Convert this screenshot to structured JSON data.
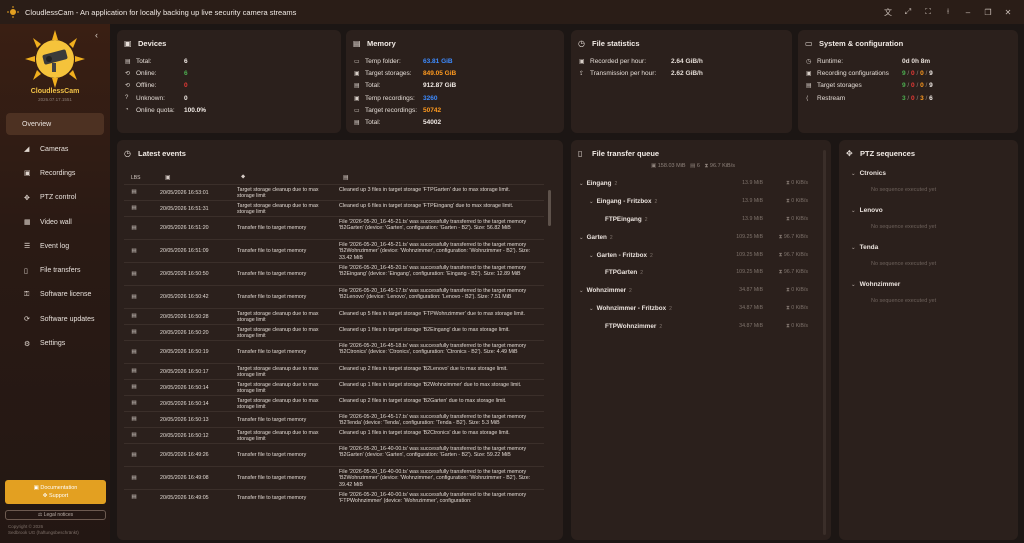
{
  "window": {
    "title": "CloudlessCam - An application for locally backing up live security camera streams",
    "controls": [
      "translate-icon",
      "fit-icon",
      "fullscreen-icon",
      "pin-icon",
      "minimize-icon",
      "restore-icon",
      "close-icon"
    ]
  },
  "sidebar": {
    "app_name": "CloudlessCam",
    "version": "2026.07.17.1551",
    "items": [
      {
        "label": "Overview",
        "icon": "home-icon",
        "active": true
      },
      {
        "label": "Cameras",
        "icon": "camera-icon"
      },
      {
        "label": "Recordings",
        "icon": "recordings-icon"
      },
      {
        "label": "PTZ control",
        "icon": "ptz-icon"
      },
      {
        "label": "Video wall",
        "icon": "grid-icon"
      },
      {
        "label": "Event log",
        "icon": "list-icon"
      },
      {
        "label": "File transfers",
        "icon": "file-icon"
      },
      {
        "label": "Software license",
        "icon": "key-icon"
      },
      {
        "label": "Software updates",
        "icon": "update-icon"
      },
      {
        "label": "Settings",
        "icon": "gear-icon"
      }
    ],
    "documentation_label": "Documentation",
    "support_label": "Support",
    "legal_label": "Legal notices",
    "copyright_line1": "Copyright © 2026",
    "copyright_line2": "Sedbrook UG (haftungsbeschränkt)",
    "accent": "#e3a021"
  },
  "devices": {
    "title": "Devices",
    "rows": [
      {
        "label": "Total:",
        "value": "6",
        "color": "#f2ebe6"
      },
      {
        "label": "Online:",
        "value": "6",
        "color": "#4caf50"
      },
      {
        "label": "Offline:",
        "value": "0",
        "color": "#e53935"
      },
      {
        "label": "Unknown:",
        "value": "0",
        "color": "#f2ebe6"
      },
      {
        "label": "Online quota:",
        "value": "100.0%",
        "color": "#f2ebe6"
      }
    ]
  },
  "memory": {
    "title": "Memory",
    "rows": [
      {
        "label": "Temp folder:",
        "value": "63.81 GiB",
        "color": "#3d8bff"
      },
      {
        "label": "Target storages:",
        "value": "849.05 GiB",
        "color": "#ff9a1f"
      },
      {
        "label": "Total:",
        "value": "912.87 GiB",
        "color": "#f2ebe6"
      },
      {
        "label": "Temp recordings:",
        "value": "3260",
        "color": "#3d8bff"
      },
      {
        "label": "Target recordings:",
        "value": "50742",
        "color": "#ff9a1f"
      },
      {
        "label": "Total:",
        "value": "54002",
        "color": "#f2ebe6"
      }
    ]
  },
  "file_statistics": {
    "title": "File statistics",
    "rows": [
      {
        "label": "Recorded per hour:",
        "value": "2.64 GiB/h"
      },
      {
        "label": "Transmission per hour:",
        "value": "2.62 GiB/h"
      }
    ]
  },
  "system": {
    "title": "System & configuration",
    "runtime_label": "Runtime:",
    "runtime_value": "0d 0h 8m",
    "rows": [
      {
        "label": "Recording configurations",
        "a": "9",
        "b": "0",
        "c": "0",
        "d": "9"
      },
      {
        "label": "Target storages",
        "a": "9",
        "b": "0",
        "c": "0",
        "d": "9"
      },
      {
        "label": "Restream",
        "a": "3",
        "b": "0",
        "c": "3",
        "d": "6"
      }
    ]
  },
  "latest_events": {
    "title": "Latest events",
    "col_source": "LBS",
    "rows": [
      {
        "icon": "doc-icon",
        "date": "20/05/2026 16:53:01",
        "type": "Target storage cleanup due to max storage limit",
        "msg": "Cleaned up 3 files in target storage 'FTPGarten' due to max storage limit.",
        "h": 16
      },
      {
        "icon": "doc-icon",
        "date": "20/05/2026 16:51:31",
        "type": "Target storage cleanup due to max storage limit",
        "msg": "Cleaned up 6 files in target storage 'FTPEingang' due to max storage limit.",
        "h": 16
      },
      {
        "icon": "doc-icon",
        "date": "20/05/2026 16:51:20",
        "type": "Transfer file to target memory",
        "msg": "File '2026-05-20_16-45-21.ts' was successfully transferred to the target memory 'B2Garten' (device: 'Garten', configuration: 'Garten - B2'). Size: 56.82 MiB",
        "h": 23
      },
      {
        "icon": "doc-icon",
        "date": "20/05/2026 16:51:09",
        "type": "Transfer file to target memory",
        "msg": "File '2026-05-20_16-45-21.ts' was successfully transferred to the target memory 'B2Wohnzimmer' (device: 'Wohnzimmer', configuration: 'Wohnzimmer - B2'). Size: 33.42 MiB",
        "h": 23
      },
      {
        "icon": "doc-icon",
        "date": "20/05/2026 16:50:50",
        "type": "Transfer file to target memory",
        "msg": "File '2026-05-20_16-45-20.ts' was successfully transferred to the target memory 'B2Eingang' (device: 'Eingang', configuration: 'Eingang - B2'). Size: 12.89 MiB",
        "h": 23
      },
      {
        "icon": "doc-icon",
        "date": "20/05/2026 16:50:42",
        "type": "Transfer file to target memory",
        "msg": "File '2026-05-20_16-45-17.ts' was successfully transferred to the target memory 'B2Lenovo' (device: 'Lenovo', configuration: 'Lenovo - B2'). Size: 7.51 MiB",
        "h": 23
      },
      {
        "icon": "doc-icon",
        "date": "20/05/2026 16:50:28",
        "type": "Target storage cleanup due to max storage limit",
        "msg": "Cleaned up 5 files in target storage 'FTPWohnzimmer' due to max storage limit.",
        "h": 16
      },
      {
        "icon": "doc-icon",
        "date": "20/05/2026 16:50:20",
        "type": "Target storage cleanup due to max storage limit",
        "msg": "Cleaned up 1 files in target storage 'B2Eingang' due to max storage limit.",
        "h": 16
      },
      {
        "icon": "doc-icon",
        "date": "20/05/2026 16:50:19",
        "type": "Transfer file to target memory",
        "msg": "File '2026-05-20_16-45-18.ts' was successfully transferred to the target memory 'B2Ctronics' (device: 'Ctronics', configuration: 'Ctronics - B2'). Size: 4.49 MiB",
        "h": 23
      },
      {
        "icon": "doc-icon",
        "date": "20/05/2026 16:50:17",
        "type": "Target storage cleanup due to max storage limit",
        "msg": "Cleaned up 2 files in target storage 'B2Lenovo' due to max storage limit.",
        "h": 16
      },
      {
        "icon": "doc-icon",
        "date": "20/05/2026 16:50:14",
        "type": "Target storage cleanup due to max storage limit",
        "msg": "Cleaned up 1 files in target storage 'B2Wohnzimmer' due to max storage limit.",
        "h": 16
      },
      {
        "icon": "doc-icon",
        "date": "20/05/2026 16:50:14",
        "type": "Target storage cleanup due to max storage limit",
        "msg": "Cleaned up 2 files in target storage 'B2Garten' due to max storage limit.",
        "h": 16
      },
      {
        "icon": "doc-icon",
        "date": "20/05/2026 16:50:13",
        "type": "Transfer file to target memory",
        "msg": "File '2026-05-20_16-45-17.ts' was successfully transferred to the target memory 'B2Tenda' (device: 'Tenda', configuration: 'Tenda - B2'). Size: 5.3 MiB",
        "h": 16
      },
      {
        "icon": "doc-icon",
        "date": "20/05/2026 16:50:12",
        "type": "Target storage cleanup due to max storage limit",
        "msg": "Cleaned up 1 files in target storage 'B2Ctronics' due to max storage limit.",
        "h": 16
      },
      {
        "icon": "doc-icon",
        "date": "20/05/2026 16:49:26",
        "type": "Transfer file to target memory",
        "msg": "File '2026-05-20_16-40-00.ts' was successfully transferred to the target memory 'B2Garten' (device: 'Garten', configuration: 'Garten - B2'). Size: 59.22 MiB",
        "h": 23
      },
      {
        "icon": "doc-icon",
        "date": "20/05/2026 16:49:08",
        "type": "Transfer file to target memory",
        "msg": "File '2026-05-20_16-40-00.ts' was successfully transferred to the target memory 'B2Wohnzimmer' (device: 'Wohnzimmer', configuration: 'Wohnzimmer - B2'). Size: 39.42 MiB",
        "h": 23
      },
      {
        "icon": "doc-icon",
        "date": "20/05/2026 16:49:05",
        "type": "Transfer file to target memory",
        "msg": "File '2026-05-20_16-40-00.ts' was successfully transferred to the target memory 'FTPWohnzimmer' (device: 'Wohnzimmer', configuration:",
        "h": 16
      }
    ]
  },
  "file_transfer_queue": {
    "title": "File transfer queue",
    "total_size": "158.03 MiB",
    "total_count": "6",
    "total_rate": "96.7 KiB/s",
    "rows": [
      {
        "level": 0,
        "name": "Eingang",
        "count": "2",
        "size": "13.9 MiB",
        "rate": "0 KiB/s",
        "chev": "v"
      },
      {
        "level": 1,
        "name": "Eingang - Fritzbox",
        "count": "2",
        "size": "13.9 MiB",
        "rate": "0 KiB/s",
        "chev": "v"
      },
      {
        "level": 2,
        "name": "FTPEingang",
        "count": "2",
        "size": "13.9 MiB",
        "rate": "0 KiB/s",
        "chev": ""
      },
      {
        "level": 0,
        "name": "Garten",
        "count": "2",
        "size": "109.25 MiB",
        "rate": "96.7 KiB/s",
        "chev": "v"
      },
      {
        "level": 1,
        "name": "Garten - Fritzbox",
        "count": "2",
        "size": "109.25 MiB",
        "rate": "96.7 KiB/s",
        "chev": "v"
      },
      {
        "level": 2,
        "name": "FTPGarten",
        "count": "2",
        "size": "109.25 MiB",
        "rate": "96.7 KiB/s",
        "chev": ""
      },
      {
        "level": 0,
        "name": "Wohnzimmer",
        "count": "2",
        "size": "34.87 MiB",
        "rate": "0 KiB/s",
        "chev": "v"
      },
      {
        "level": 1,
        "name": "Wohnzimmer - Fritzbox",
        "count": "2",
        "size": "34.87 MiB",
        "rate": "0 KiB/s",
        "chev": "v"
      },
      {
        "level": 2,
        "name": "FTPWohnzimmer",
        "count": "2",
        "size": "34.87 MiB",
        "rate": "0 KiB/s",
        "chev": ""
      }
    ]
  },
  "ptz_sequences": {
    "title": "PTZ sequences",
    "empty_text": "No sequence executed yet",
    "groups": [
      "Ctronics",
      "Lenovo",
      "Tenda",
      "Wohnzimmer"
    ]
  }
}
